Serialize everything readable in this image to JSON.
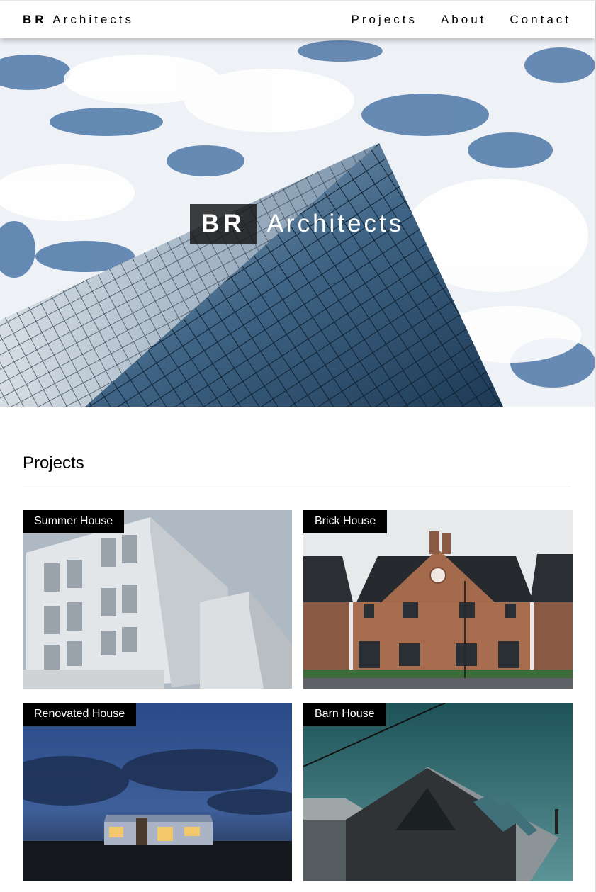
{
  "navbar": {
    "brand_bold": "BR",
    "brand_rest": "Architects",
    "links": [
      "Projects",
      "About",
      "Contact"
    ]
  },
  "hero": {
    "title_bold": "BR",
    "title_rest": "Architects"
  },
  "projects": {
    "heading": "Projects",
    "items": [
      {
        "label": "Summer House"
      },
      {
        "label": "Brick House"
      },
      {
        "label": "Renovated House"
      },
      {
        "label": "Barn House"
      }
    ]
  }
}
